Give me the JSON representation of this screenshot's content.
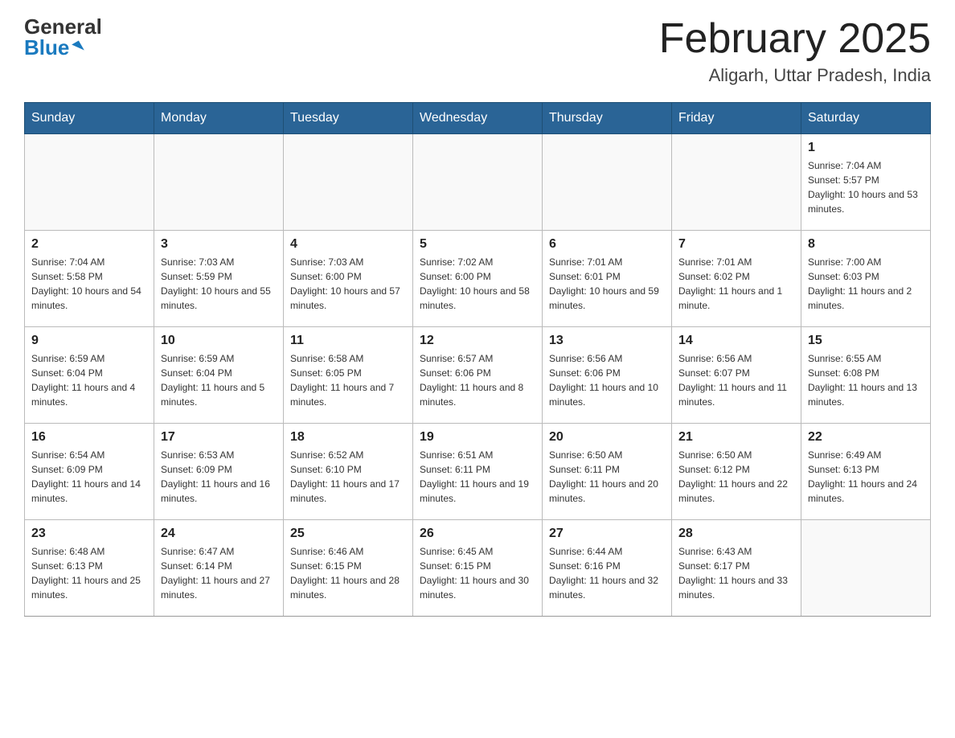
{
  "header": {
    "logo_general": "General",
    "logo_blue": "Blue",
    "month_title": "February 2025",
    "location": "Aligarh, Uttar Pradesh, India"
  },
  "weekdays": [
    "Sunday",
    "Monday",
    "Tuesday",
    "Wednesday",
    "Thursday",
    "Friday",
    "Saturday"
  ],
  "weeks": [
    [
      {
        "day": "",
        "info": ""
      },
      {
        "day": "",
        "info": ""
      },
      {
        "day": "",
        "info": ""
      },
      {
        "day": "",
        "info": ""
      },
      {
        "day": "",
        "info": ""
      },
      {
        "day": "",
        "info": ""
      },
      {
        "day": "1",
        "info": "Sunrise: 7:04 AM\nSunset: 5:57 PM\nDaylight: 10 hours and 53 minutes."
      }
    ],
    [
      {
        "day": "2",
        "info": "Sunrise: 7:04 AM\nSunset: 5:58 PM\nDaylight: 10 hours and 54 minutes."
      },
      {
        "day": "3",
        "info": "Sunrise: 7:03 AM\nSunset: 5:59 PM\nDaylight: 10 hours and 55 minutes."
      },
      {
        "day": "4",
        "info": "Sunrise: 7:03 AM\nSunset: 6:00 PM\nDaylight: 10 hours and 57 minutes."
      },
      {
        "day": "5",
        "info": "Sunrise: 7:02 AM\nSunset: 6:00 PM\nDaylight: 10 hours and 58 minutes."
      },
      {
        "day": "6",
        "info": "Sunrise: 7:01 AM\nSunset: 6:01 PM\nDaylight: 10 hours and 59 minutes."
      },
      {
        "day": "7",
        "info": "Sunrise: 7:01 AM\nSunset: 6:02 PM\nDaylight: 11 hours and 1 minute."
      },
      {
        "day": "8",
        "info": "Sunrise: 7:00 AM\nSunset: 6:03 PM\nDaylight: 11 hours and 2 minutes."
      }
    ],
    [
      {
        "day": "9",
        "info": "Sunrise: 6:59 AM\nSunset: 6:04 PM\nDaylight: 11 hours and 4 minutes."
      },
      {
        "day": "10",
        "info": "Sunrise: 6:59 AM\nSunset: 6:04 PM\nDaylight: 11 hours and 5 minutes."
      },
      {
        "day": "11",
        "info": "Sunrise: 6:58 AM\nSunset: 6:05 PM\nDaylight: 11 hours and 7 minutes."
      },
      {
        "day": "12",
        "info": "Sunrise: 6:57 AM\nSunset: 6:06 PM\nDaylight: 11 hours and 8 minutes."
      },
      {
        "day": "13",
        "info": "Sunrise: 6:56 AM\nSunset: 6:06 PM\nDaylight: 11 hours and 10 minutes."
      },
      {
        "day": "14",
        "info": "Sunrise: 6:56 AM\nSunset: 6:07 PM\nDaylight: 11 hours and 11 minutes."
      },
      {
        "day": "15",
        "info": "Sunrise: 6:55 AM\nSunset: 6:08 PM\nDaylight: 11 hours and 13 minutes."
      }
    ],
    [
      {
        "day": "16",
        "info": "Sunrise: 6:54 AM\nSunset: 6:09 PM\nDaylight: 11 hours and 14 minutes."
      },
      {
        "day": "17",
        "info": "Sunrise: 6:53 AM\nSunset: 6:09 PM\nDaylight: 11 hours and 16 minutes."
      },
      {
        "day": "18",
        "info": "Sunrise: 6:52 AM\nSunset: 6:10 PM\nDaylight: 11 hours and 17 minutes."
      },
      {
        "day": "19",
        "info": "Sunrise: 6:51 AM\nSunset: 6:11 PM\nDaylight: 11 hours and 19 minutes."
      },
      {
        "day": "20",
        "info": "Sunrise: 6:50 AM\nSunset: 6:11 PM\nDaylight: 11 hours and 20 minutes."
      },
      {
        "day": "21",
        "info": "Sunrise: 6:50 AM\nSunset: 6:12 PM\nDaylight: 11 hours and 22 minutes."
      },
      {
        "day": "22",
        "info": "Sunrise: 6:49 AM\nSunset: 6:13 PM\nDaylight: 11 hours and 24 minutes."
      }
    ],
    [
      {
        "day": "23",
        "info": "Sunrise: 6:48 AM\nSunset: 6:13 PM\nDaylight: 11 hours and 25 minutes."
      },
      {
        "day": "24",
        "info": "Sunrise: 6:47 AM\nSunset: 6:14 PM\nDaylight: 11 hours and 27 minutes."
      },
      {
        "day": "25",
        "info": "Sunrise: 6:46 AM\nSunset: 6:15 PM\nDaylight: 11 hours and 28 minutes."
      },
      {
        "day": "26",
        "info": "Sunrise: 6:45 AM\nSunset: 6:15 PM\nDaylight: 11 hours and 30 minutes."
      },
      {
        "day": "27",
        "info": "Sunrise: 6:44 AM\nSunset: 6:16 PM\nDaylight: 11 hours and 32 minutes."
      },
      {
        "day": "28",
        "info": "Sunrise: 6:43 AM\nSunset: 6:17 PM\nDaylight: 11 hours and 33 minutes."
      },
      {
        "day": "",
        "info": ""
      }
    ]
  ]
}
